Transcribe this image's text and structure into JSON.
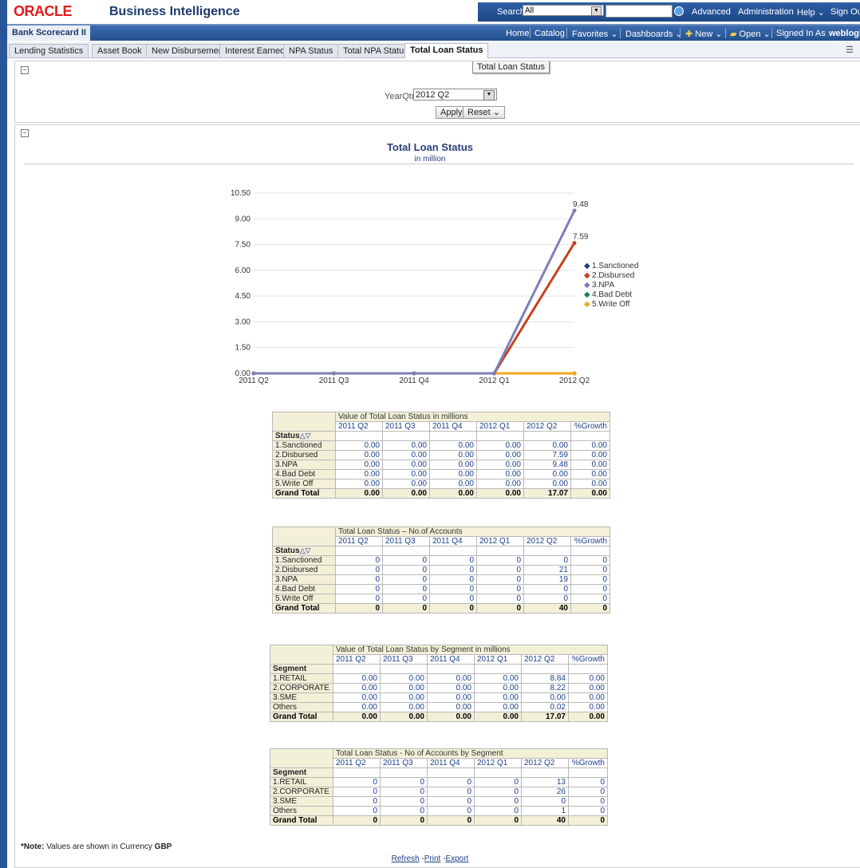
{
  "header": {
    "logo": "ORACLE",
    "product": "Business Intelligence",
    "search_label": "Search",
    "search_scope": "All",
    "advanced": "Advanced",
    "administration": "Administration",
    "help": "Help ⌄",
    "signout": "Sign Out"
  },
  "nav": {
    "dashboard_title": "Bank Scorecard II",
    "home": "Home",
    "catalog": "Catalog",
    "favorites": "Favorites ⌄",
    "dashboards": "Dashboards ⌄",
    "new": "New ⌄",
    "open": "Open ⌄",
    "signed_in_as": "Signed In As",
    "user": "weblogi"
  },
  "tabs": [
    "Lending Statistics",
    "Asset Book",
    "New Disbursements",
    "Interest Earned",
    "NPA Status",
    "Total NPA Status",
    "Total Loan Status"
  ],
  "tooltip": "Total Loan Status",
  "prompt": {
    "label": "YearQtr",
    "value": "2012 Q2",
    "apply": "Apply",
    "reset": "Reset ⌄"
  },
  "chart_title": "Total Loan Status",
  "chart_subtitle": "in million",
  "chart_data": {
    "type": "line",
    "title": "Total Loan Status",
    "subtitle": "in million",
    "x": [
      "2011 Q2",
      "2011 Q3",
      "2011 Q4",
      "2012 Q1",
      "2012 Q2"
    ],
    "ylim": [
      0,
      10.5
    ],
    "yticks": [
      "0.00",
      "1.50",
      "3.00",
      "4.50",
      "6.00",
      "7.50",
      "9.00",
      "10.50"
    ],
    "legend_position": "right",
    "series": [
      {
        "name": "1.Sanctioned",
        "values": [
          0,
          0,
          0,
          0,
          0
        ],
        "color": "#1f3f78"
      },
      {
        "name": "2.Disbursed",
        "values": [
          0,
          0,
          0,
          0,
          7.59
        ],
        "color": "#c8401c"
      },
      {
        "name": "3.NPA",
        "values": [
          0,
          0,
          0,
          0,
          9.48
        ],
        "color": "#7e7fb8"
      },
      {
        "name": "4.Bad Debt",
        "values": [
          0,
          0,
          0,
          0,
          0
        ],
        "color": "#1a7a6e"
      },
      {
        "name": "5.Write Off",
        "values": [
          0,
          0,
          0,
          0,
          0
        ],
        "color": "#f0a81e"
      }
    ],
    "data_labels": [
      {
        "series": "3.NPA",
        "x": "2012 Q2",
        "label": "9.48"
      },
      {
        "series": "2.Disbursed",
        "x": "2012 Q2",
        "label": "7.59"
      }
    ]
  },
  "tables": [
    {
      "title": "Value of Total Loan Status in millions",
      "row_header": "Status",
      "sortable": true,
      "columns": [
        "2011 Q2",
        "2011 Q3",
        "2011 Q4",
        "2012 Q1",
        "2012 Q2",
        "%Growth"
      ],
      "rows": [
        [
          "1.Sanctioned",
          "0.00",
          "0.00",
          "0.00",
          "0.00",
          "0.00",
          "0.00"
        ],
        [
          "2.Disbursed",
          "0.00",
          "0.00",
          "0.00",
          "0.00",
          "7.59",
          "0.00"
        ],
        [
          "3.NPA",
          "0.00",
          "0.00",
          "0.00",
          "0.00",
          "9.48",
          "0.00"
        ],
        [
          "4.Bad Debt",
          "0.00",
          "0.00",
          "0.00",
          "0.00",
          "0.00",
          "0.00"
        ],
        [
          "5.Write Off",
          "0.00",
          "0.00",
          "0.00",
          "0.00",
          "0.00",
          "0.00"
        ]
      ],
      "total": [
        "Grand Total",
        "0.00",
        "0.00",
        "0.00",
        "0.00",
        "17.07",
        "0.00"
      ]
    },
    {
      "title": "Total Loan Status – No.of Accounts",
      "row_header": "Status",
      "sortable": true,
      "columns": [
        "2011 Q2",
        "2011 Q3",
        "2011 Q4",
        "2012 Q1",
        "2012 Q2",
        "%Growth"
      ],
      "rows": [
        [
          "1.Sanctioned",
          "0",
          "0",
          "0",
          "0",
          "0",
          "0"
        ],
        [
          "2.Disbursed",
          "0",
          "0",
          "0",
          "0",
          "21",
          "0"
        ],
        [
          "3.NPA",
          "0",
          "0",
          "0",
          "0",
          "19",
          "0"
        ],
        [
          "4.Bad Debt",
          "0",
          "0",
          "0",
          "0",
          "0",
          "0"
        ],
        [
          "5.Write Off",
          "0",
          "0",
          "0",
          "0",
          "0",
          "0"
        ]
      ],
      "total": [
        "Grand Total",
        "0",
        "0",
        "0",
        "0",
        "40",
        "0"
      ]
    },
    {
      "title": "Value of Total Loan Status by Segment in millions",
      "row_header": "Segment",
      "sortable": false,
      "columns": [
        "2011 Q2",
        "2011 Q3",
        "2011 Q4",
        "2012 Q1",
        "2012 Q2",
        "%Growth"
      ],
      "rows": [
        [
          "1.RETAIL",
          "0.00",
          "0.00",
          "0.00",
          "0.00",
          "8.84",
          "0.00"
        ],
        [
          "2.CORPORATE",
          "0.00",
          "0.00",
          "0.00",
          "0.00",
          "8.22",
          "0.00"
        ],
        [
          "3.SME",
          "0.00",
          "0.00",
          "0.00",
          "0.00",
          "0.00",
          "0.00"
        ],
        [
          "Others",
          "0.00",
          "0.00",
          "0.00",
          "0.00",
          "0.02",
          "0.00"
        ]
      ],
      "total": [
        "Grand Total",
        "0.00",
        "0.00",
        "0.00",
        "0.00",
        "17.07",
        "0.00"
      ]
    },
    {
      "title": "Total Loan Status - No of Accounts by Segment",
      "row_header": "Segment",
      "sortable": false,
      "columns": [
        "2011 Q2",
        "2011 Q3",
        "2011 Q4",
        "2012 Q1",
        "2012 Q2",
        "%Growth"
      ],
      "rows": [
        [
          "1.RETAIL",
          "0",
          "0",
          "0",
          "0",
          "13",
          "0"
        ],
        [
          "2.CORPORATE",
          "0",
          "0",
          "0",
          "0",
          "26",
          "0"
        ],
        [
          "3.SME",
          "0",
          "0",
          "0",
          "0",
          "0",
          "0"
        ],
        [
          "Others",
          "0",
          "0",
          "0",
          "0",
          "1",
          "0"
        ]
      ],
      "total": [
        "Grand Total",
        "0",
        "0",
        "0",
        "0",
        "40",
        "0"
      ]
    }
  ],
  "note": {
    "prefix": "*Note:",
    "text": " Values are shown in Currency ",
    "currency": "GBP"
  },
  "footer_links": [
    "Refresh",
    "Print",
    "Export"
  ]
}
